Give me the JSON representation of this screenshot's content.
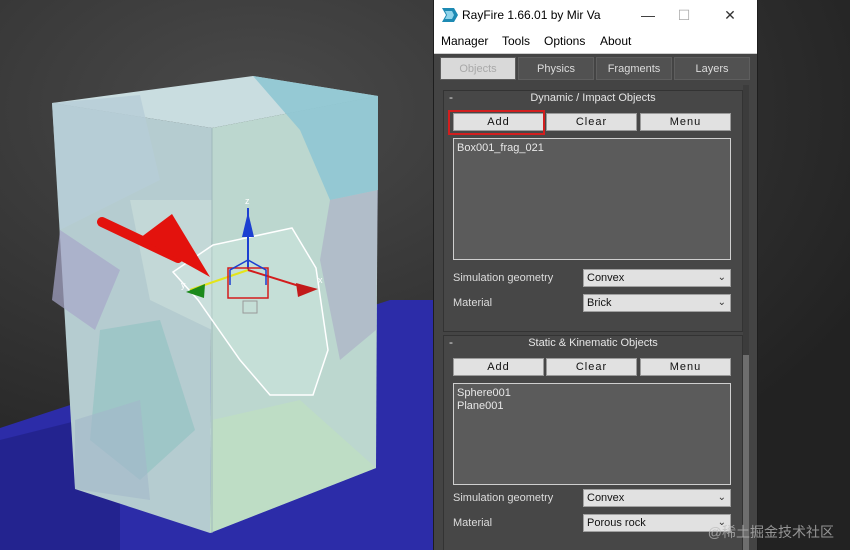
{
  "window": {
    "title": "RayFire 1.66.01  by Mir Va",
    "controls": {
      "minimize": "—",
      "maximize": "☐",
      "close": "✕"
    }
  },
  "menu": [
    "Manager",
    "Tools",
    "Options",
    "About"
  ],
  "tabs": [
    "Objects",
    "Physics",
    "Fragments",
    "Layers"
  ],
  "dynamic_rollout": {
    "title": "Dynamic / Impact Objects",
    "collapse": "-",
    "add": "Add",
    "clear": "Clear",
    "menu": "Menu",
    "items": [
      "Box001_frag_021"
    ],
    "sim_geo_label": "Simulation geometry",
    "sim_geo_value": "Convex",
    "material_label": "Material",
    "material_value": "Brick"
  },
  "static_rollout": {
    "title": "Static & Kinematic Objects",
    "collapse": "-",
    "add": "Add",
    "clear": "Clear",
    "menu": "Menu",
    "items": [
      "Sphere001",
      "Plane001"
    ],
    "sim_geo_label": "Simulation geometry",
    "sim_geo_value": "Convex",
    "material_label": "Material",
    "material_value": "Porous rock"
  },
  "gizmo": {
    "x": "x",
    "y": "y",
    "z": "z"
  },
  "watermark": "@稀土掘金技术社区",
  "colors": {
    "highlight": "#d21e1e",
    "arrow": "#e3120d",
    "floor": "#2c2ca8",
    "panel": "#444444"
  }
}
